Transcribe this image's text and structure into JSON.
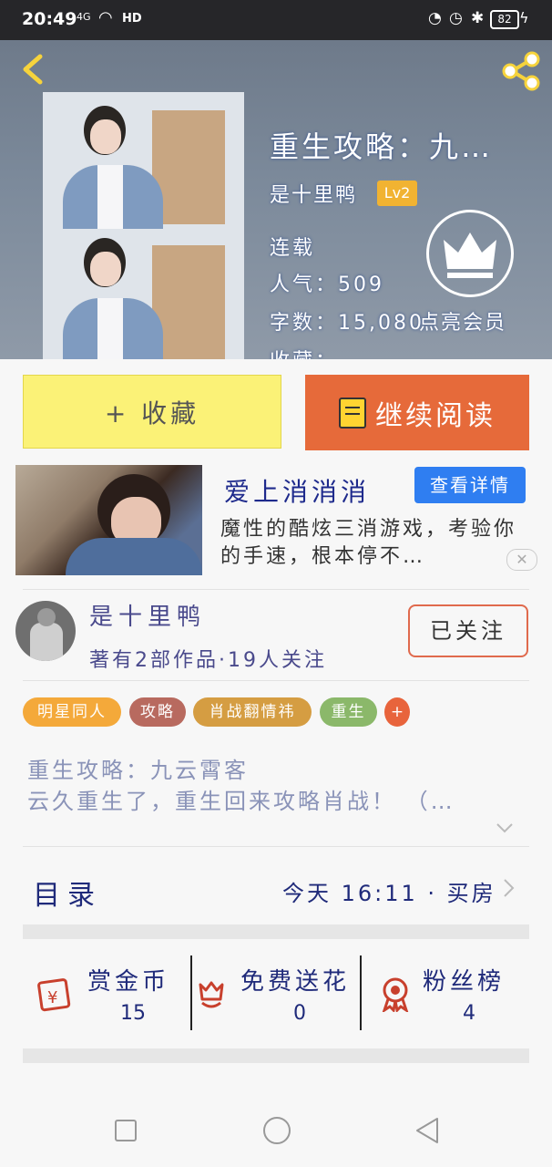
{
  "status_bar": {
    "time": "20:49",
    "network": "4G",
    "hd": "HD",
    "battery": "82"
  },
  "header": {
    "book_title": "重生攻略：九…",
    "author": "是十里鸭",
    "author_level": "Lv2",
    "status": "连载",
    "popularity": "人气：509",
    "word_count": "字数：15,080",
    "collects_partial": "收藏：",
    "vip_label": "点亮会员"
  },
  "actions": {
    "collect_label": "+ 收藏",
    "read_label": "继续阅读"
  },
  "ad": {
    "title": "爱上消消消",
    "detail_button": "查看详情",
    "description": "魔性的酷炫三消游戏，考验你的手速，根本停不…",
    "close": "✕"
  },
  "author_card": {
    "name": "是十里鸭",
    "stats": "著有2部作品·19人关注",
    "follow_label": "已关注"
  },
  "tags": [
    {
      "label": "明星同人",
      "color": "#f4a93a"
    },
    {
      "label": "攻略",
      "color": "#b86a5f"
    },
    {
      "label": "肖战翻情祎",
      "color": "#d59d42"
    },
    {
      "label": "重生",
      "color": "#8bb86a"
    },
    {
      "label": "+",
      "color": "#e8643c"
    }
  ],
  "synopsis": [
    "重生攻略：九云霄客",
    "云久重生了，重生回来攻略肖战！ （…"
  ],
  "catalog": {
    "label": "目录",
    "update": "今天 16:11 · 买房"
  },
  "stats": [
    {
      "label": "赏金币",
      "value": "15",
      "icon": "reward-coin-icon"
    },
    {
      "label": "免费送花",
      "value": "0",
      "icon": "flower-icon"
    },
    {
      "label": "粉丝榜",
      "value": "4",
      "icon": "medal-icon"
    }
  ],
  "colors": {
    "primary_orange": "#e66a3a",
    "collect_yellow": "#fbf277",
    "ad_blue": "#2f7ef1"
  }
}
